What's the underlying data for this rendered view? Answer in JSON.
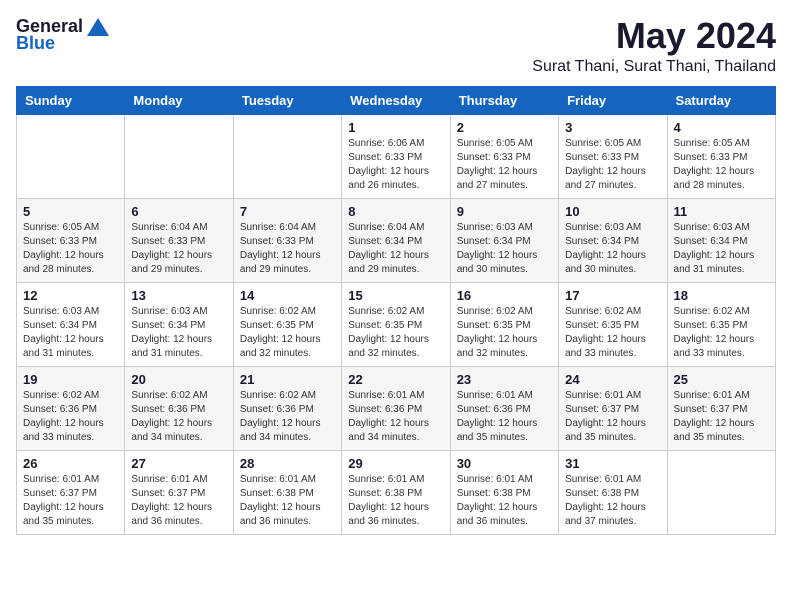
{
  "logo": {
    "general": "General",
    "blue": "Blue"
  },
  "title": {
    "month": "May 2024",
    "location": "Surat Thani, Surat Thani, Thailand"
  },
  "headers": [
    "Sunday",
    "Monday",
    "Tuesday",
    "Wednesday",
    "Thursday",
    "Friday",
    "Saturday"
  ],
  "weeks": [
    [
      {
        "day": "",
        "info": ""
      },
      {
        "day": "",
        "info": ""
      },
      {
        "day": "",
        "info": ""
      },
      {
        "day": "1",
        "info": "Sunrise: 6:06 AM\nSunset: 6:33 PM\nDaylight: 12 hours\nand 26 minutes."
      },
      {
        "day": "2",
        "info": "Sunrise: 6:05 AM\nSunset: 6:33 PM\nDaylight: 12 hours\nand 27 minutes."
      },
      {
        "day": "3",
        "info": "Sunrise: 6:05 AM\nSunset: 6:33 PM\nDaylight: 12 hours\nand 27 minutes."
      },
      {
        "day": "4",
        "info": "Sunrise: 6:05 AM\nSunset: 6:33 PM\nDaylight: 12 hours\nand 28 minutes."
      }
    ],
    [
      {
        "day": "5",
        "info": "Sunrise: 6:05 AM\nSunset: 6:33 PM\nDaylight: 12 hours\nand 28 minutes."
      },
      {
        "day": "6",
        "info": "Sunrise: 6:04 AM\nSunset: 6:33 PM\nDaylight: 12 hours\nand 29 minutes."
      },
      {
        "day": "7",
        "info": "Sunrise: 6:04 AM\nSunset: 6:33 PM\nDaylight: 12 hours\nand 29 minutes."
      },
      {
        "day": "8",
        "info": "Sunrise: 6:04 AM\nSunset: 6:34 PM\nDaylight: 12 hours\nand 29 minutes."
      },
      {
        "day": "9",
        "info": "Sunrise: 6:03 AM\nSunset: 6:34 PM\nDaylight: 12 hours\nand 30 minutes."
      },
      {
        "day": "10",
        "info": "Sunrise: 6:03 AM\nSunset: 6:34 PM\nDaylight: 12 hours\nand 30 minutes."
      },
      {
        "day": "11",
        "info": "Sunrise: 6:03 AM\nSunset: 6:34 PM\nDaylight: 12 hours\nand 31 minutes."
      }
    ],
    [
      {
        "day": "12",
        "info": "Sunrise: 6:03 AM\nSunset: 6:34 PM\nDaylight: 12 hours\nand 31 minutes."
      },
      {
        "day": "13",
        "info": "Sunrise: 6:03 AM\nSunset: 6:34 PM\nDaylight: 12 hours\nand 31 minutes."
      },
      {
        "day": "14",
        "info": "Sunrise: 6:02 AM\nSunset: 6:35 PM\nDaylight: 12 hours\nand 32 minutes."
      },
      {
        "day": "15",
        "info": "Sunrise: 6:02 AM\nSunset: 6:35 PM\nDaylight: 12 hours\nand 32 minutes."
      },
      {
        "day": "16",
        "info": "Sunrise: 6:02 AM\nSunset: 6:35 PM\nDaylight: 12 hours\nand 32 minutes."
      },
      {
        "day": "17",
        "info": "Sunrise: 6:02 AM\nSunset: 6:35 PM\nDaylight: 12 hours\nand 33 minutes."
      },
      {
        "day": "18",
        "info": "Sunrise: 6:02 AM\nSunset: 6:35 PM\nDaylight: 12 hours\nand 33 minutes."
      }
    ],
    [
      {
        "day": "19",
        "info": "Sunrise: 6:02 AM\nSunset: 6:36 PM\nDaylight: 12 hours\nand 33 minutes."
      },
      {
        "day": "20",
        "info": "Sunrise: 6:02 AM\nSunset: 6:36 PM\nDaylight: 12 hours\nand 34 minutes."
      },
      {
        "day": "21",
        "info": "Sunrise: 6:02 AM\nSunset: 6:36 PM\nDaylight: 12 hours\nand 34 minutes."
      },
      {
        "day": "22",
        "info": "Sunrise: 6:01 AM\nSunset: 6:36 PM\nDaylight: 12 hours\nand 34 minutes."
      },
      {
        "day": "23",
        "info": "Sunrise: 6:01 AM\nSunset: 6:36 PM\nDaylight: 12 hours\nand 35 minutes."
      },
      {
        "day": "24",
        "info": "Sunrise: 6:01 AM\nSunset: 6:37 PM\nDaylight: 12 hours\nand 35 minutes."
      },
      {
        "day": "25",
        "info": "Sunrise: 6:01 AM\nSunset: 6:37 PM\nDaylight: 12 hours\nand 35 minutes."
      }
    ],
    [
      {
        "day": "26",
        "info": "Sunrise: 6:01 AM\nSunset: 6:37 PM\nDaylight: 12 hours\nand 35 minutes."
      },
      {
        "day": "27",
        "info": "Sunrise: 6:01 AM\nSunset: 6:37 PM\nDaylight: 12 hours\nand 36 minutes."
      },
      {
        "day": "28",
        "info": "Sunrise: 6:01 AM\nSunset: 6:38 PM\nDaylight: 12 hours\nand 36 minutes."
      },
      {
        "day": "29",
        "info": "Sunrise: 6:01 AM\nSunset: 6:38 PM\nDaylight: 12 hours\nand 36 minutes."
      },
      {
        "day": "30",
        "info": "Sunrise: 6:01 AM\nSunset: 6:38 PM\nDaylight: 12 hours\nand 36 minutes."
      },
      {
        "day": "31",
        "info": "Sunrise: 6:01 AM\nSunset: 6:38 PM\nDaylight: 12 hours\nand 37 minutes."
      },
      {
        "day": "",
        "info": ""
      }
    ]
  ]
}
